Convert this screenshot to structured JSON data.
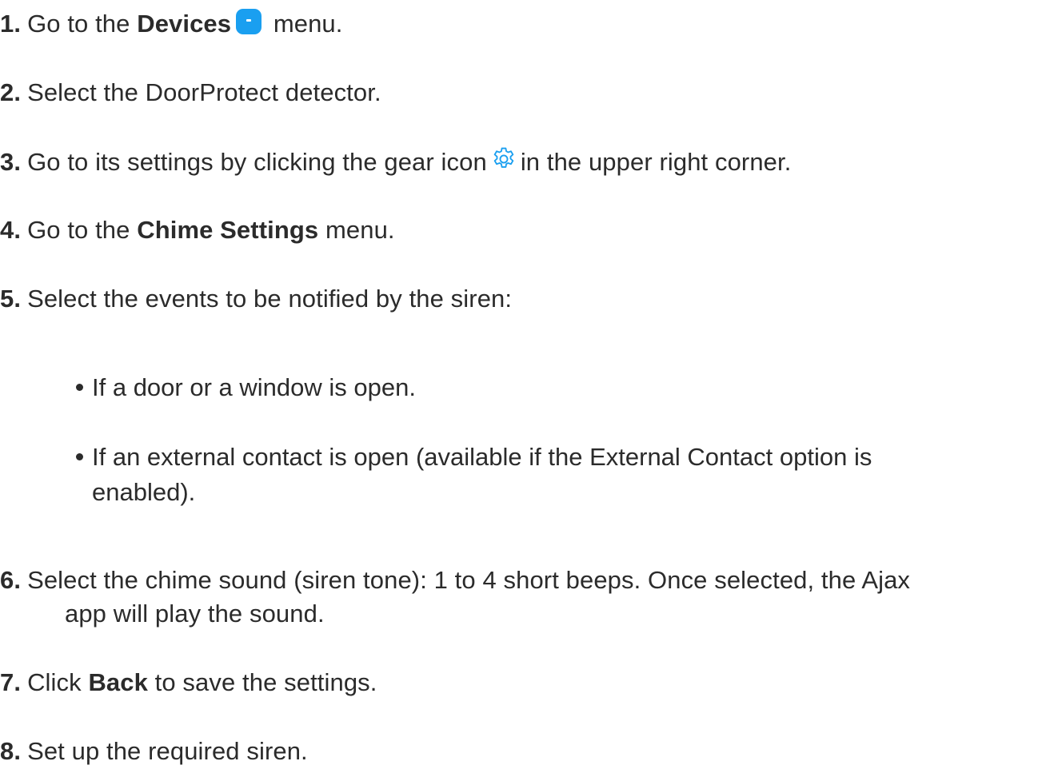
{
  "steps": [
    {
      "num": "1.",
      "pre": "Go to the ",
      "bold": "Devices",
      "post": " menu."
    },
    {
      "num": "2.",
      "text": "Select the DoorProtect detector."
    },
    {
      "num": "3.",
      "pre": "Go to its settings by clicking the gear icon",
      "post": "in the upper right corner."
    },
    {
      "num": "4.",
      "pre": "Go to the ",
      "bold": "Chime Settings",
      "post": " menu."
    },
    {
      "num": "5.",
      "text": "Select the events to be notified by the siren:"
    },
    {
      "num": "6.",
      "line1": "Select the chime sound (siren tone): 1 to 4 short beeps. Once selected, the Ajax",
      "line2": "app will play the sound."
    },
    {
      "num": "7.",
      "pre": "Click ",
      "bold": "Back",
      "post": " to save the settings."
    },
    {
      "num": "8.",
      "text": "Set up the required siren."
    }
  ],
  "bullets": [
    {
      "text": "If a door or a window is open."
    },
    {
      "line1": "If an external contact is open (available if the External Contact option is",
      "line2": "enabled)."
    }
  ],
  "icons": {
    "devices": "devices-icon",
    "gear": "gear-icon"
  },
  "colors": {
    "text": "#2b2b2b",
    "accent": "#1a9ff0"
  }
}
